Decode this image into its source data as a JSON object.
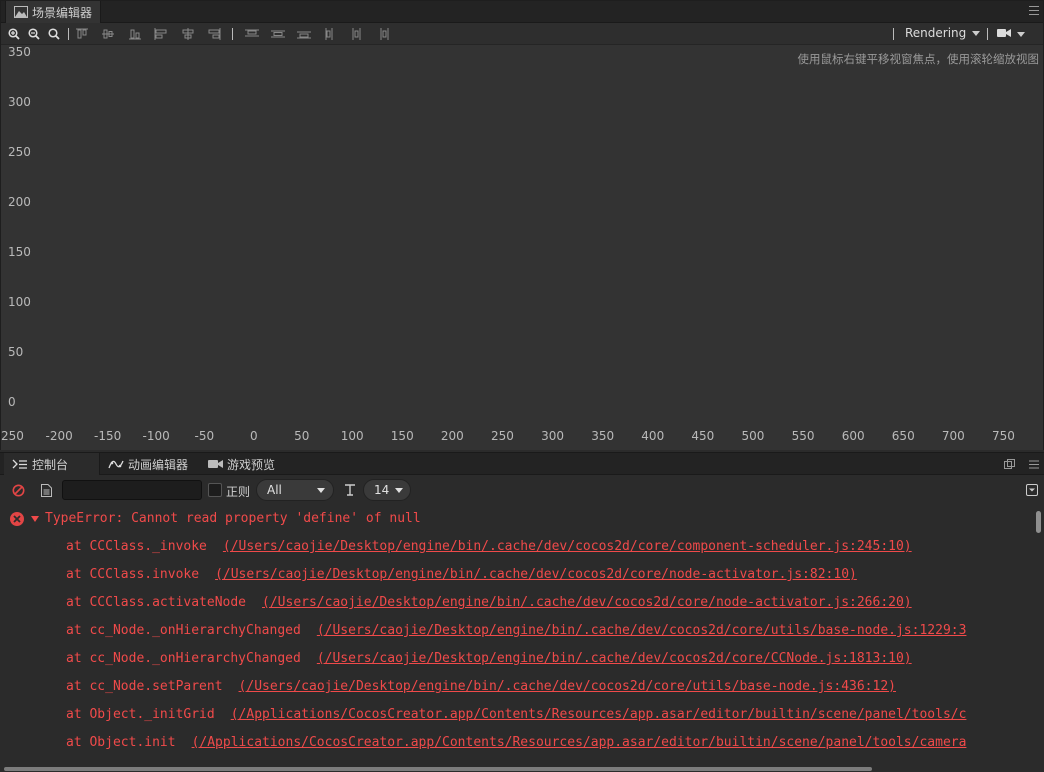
{
  "scene": {
    "tab_title": "场景编辑器",
    "rendering_label": "Rendering",
    "hint": "使用鼠标右键平移视窗焦点，使用滚轮缩放视图",
    "y_ticks": [
      "350",
      "300",
      "250",
      "200",
      "150",
      "100",
      "50",
      "0"
    ],
    "x_ticks": [
      "250",
      "-200",
      "-150",
      "-100",
      "-50",
      "0",
      "50",
      "100",
      "150",
      "200",
      "250",
      "300",
      "350",
      "400",
      "450",
      "500",
      "550",
      "600",
      "650",
      "700",
      "750"
    ],
    "icons": [
      "zoom-in-icon",
      "zoom-out-icon",
      "zoom-reset-icon",
      "align-top-icon",
      "align-v-center-icon",
      "align-bottom-icon",
      "align-left-icon",
      "align-h-center-icon",
      "align-right-icon",
      "distribute-top-icon",
      "distribute-v-center-icon",
      "distribute-bottom-icon",
      "distribute-left-icon",
      "distribute-h-center-icon",
      "distribute-right-icon",
      "camera-icon"
    ]
  },
  "console": {
    "tabs": [
      {
        "label": "控制台",
        "icon": "terminal-icon"
      },
      {
        "label": "动画编辑器",
        "icon": "animation-icon"
      },
      {
        "label": "游戏预览",
        "icon": "video-icon"
      }
    ],
    "filter_placeholder": "",
    "regex_label": "正则",
    "level_select": "All",
    "font_size_select": "14",
    "error": {
      "message": "TypeError: Cannot read property 'define' of null",
      "frames": [
        {
          "fn": "at CCClass._invoke",
          "path": "(/Users/caojie/Desktop/engine/bin/.cache/dev/cocos2d/core/component-scheduler.js:245:10)"
        },
        {
          "fn": "at CCClass.invoke",
          "path": "(/Users/caojie/Desktop/engine/bin/.cache/dev/cocos2d/core/node-activator.js:82:10)"
        },
        {
          "fn": "at CCClass.activateNode",
          "path": "(/Users/caojie/Desktop/engine/bin/.cache/dev/cocos2d/core/node-activator.js:266:20)"
        },
        {
          "fn": "at cc_Node._onHierarchyChanged",
          "path": "(/Users/caojie/Desktop/engine/bin/.cache/dev/cocos2d/core/utils/base-node.js:1229:3"
        },
        {
          "fn": "at cc_Node._onHierarchyChanged",
          "path": "(/Users/caojie/Desktop/engine/bin/.cache/dev/cocos2d/core/CCNode.js:1813:10)"
        },
        {
          "fn": "at cc_Node.setParent",
          "path": "(/Users/caojie/Desktop/engine/bin/.cache/dev/cocos2d/core/utils/base-node.js:436:12)"
        },
        {
          "fn": "at Object._initGrid",
          "path": "(/Applications/CocosCreator.app/Contents/Resources/app.asar/editor/builtin/scene/panel/tools/c"
        },
        {
          "fn": "at Object.init",
          "path": "(/Applications/CocosCreator.app/Contents/Resources/app.asar/editor/builtin/scene/panel/tools/camera"
        }
      ]
    }
  },
  "colors": {
    "error_red": "#f04a4a",
    "panel_bg": "#333333",
    "console_bg": "#2b2b2b"
  }
}
